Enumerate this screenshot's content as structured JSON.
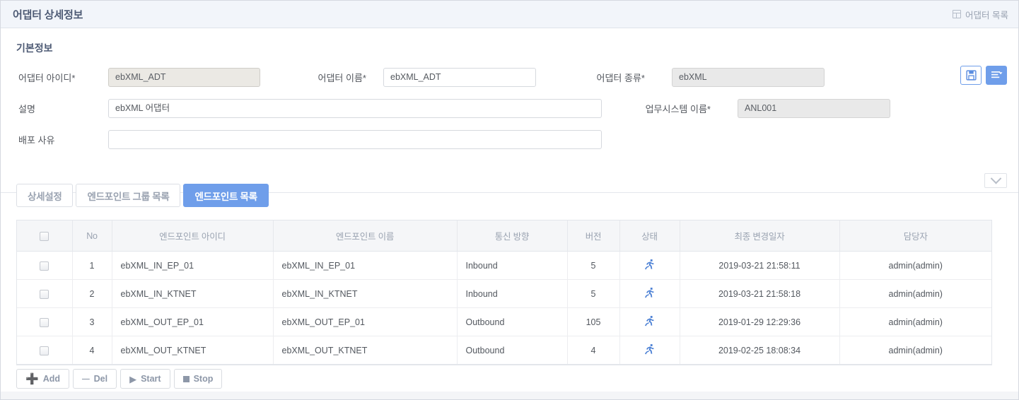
{
  "header": {
    "title": "어댑터 상세정보",
    "breadcrumb_label": "어댑터 목록",
    "breadcrumb_icon": "grid-icon"
  },
  "basic_info": {
    "section_title": "기본정보",
    "actions": [
      {
        "name": "save-button",
        "icon": "floppy-disk-icon",
        "style": "ghost"
      },
      {
        "name": "menu-button",
        "icon": "list-dropdown-icon",
        "style": "solid"
      }
    ],
    "collapse_icon": "chevron-down-icon",
    "fields": {
      "adapter_id": {
        "label": "어댑터 아이디*",
        "value": "ebXML_ADT",
        "placeholder": "",
        "readonly": true
      },
      "adapter_name": {
        "label": "어댑터 이름*",
        "value": "ebXML_ADT",
        "placeholder": "",
        "readonly": false
      },
      "adapter_type": {
        "label": "어댑터 종류*",
        "value": "ebXML",
        "placeholder": "",
        "readonly": true
      },
      "description": {
        "label": "설명",
        "value": "ebXML 어댑터",
        "placeholder": "",
        "readonly": false
      },
      "system_name": {
        "label": "업무시스템 이름*",
        "value": "ANL001",
        "placeholder": "",
        "readonly": true
      },
      "deploy_reason": {
        "label": "배포 사유",
        "value": "",
        "placeholder": "",
        "readonly": false
      }
    }
  },
  "tabs": [
    {
      "label": "상세설정",
      "active": false
    },
    {
      "label": "엔드포인트 그룹 목록",
      "active": false
    },
    {
      "label": "엔드포인트 목록",
      "active": true
    }
  ],
  "table": {
    "columns": [
      "",
      "No",
      "엔드포인트 아이디",
      "엔드포인트 이름",
      "통신 방향",
      "버전",
      "상태",
      "최종 변경일자",
      "담당자"
    ],
    "rows": [
      {
        "no": "1",
        "endpoint_id": "ebXML_IN_EP_01",
        "endpoint_name": "ebXML_IN_EP_01",
        "direction": "Inbound",
        "version": "5",
        "status": "running-icon",
        "last_modified": "2019-03-21 21:58:11",
        "owner": "admin(admin)"
      },
      {
        "no": "2",
        "endpoint_id": "ebXML_IN_KTNET",
        "endpoint_name": "ebXML_IN_KTNET",
        "direction": "Inbound",
        "version": "5",
        "status": "running-icon",
        "last_modified": "2019-03-21 21:58:18",
        "owner": "admin(admin)"
      },
      {
        "no": "3",
        "endpoint_id": "ebXML_OUT_EP_01",
        "endpoint_name": "ebXML_OUT_EP_01",
        "direction": "Outbound",
        "version": "105",
        "status": "running-icon",
        "last_modified": "2019-01-29 12:29:36",
        "owner": "admin(admin)"
      },
      {
        "no": "4",
        "endpoint_id": "ebXML_OUT_KTNET",
        "endpoint_name": "ebXML_OUT_KTNET",
        "direction": "Outbound",
        "version": "4",
        "status": "running-icon",
        "last_modified": "2019-02-25 18:08:34",
        "owner": "admin(admin)"
      }
    ]
  },
  "toolbar": [
    {
      "label": "Add",
      "icon": "plus-icon"
    },
    {
      "label": "Del",
      "icon": "minus-icon"
    },
    {
      "label": "Start",
      "icon": "play-icon"
    },
    {
      "label": "Stop",
      "icon": "stop-icon"
    }
  ],
  "colors": {
    "accent": "#6f9eea",
    "title_text": "#4d5a74",
    "header_bg": "#f2f5fa",
    "readonly_field": "#ebe9e4"
  }
}
